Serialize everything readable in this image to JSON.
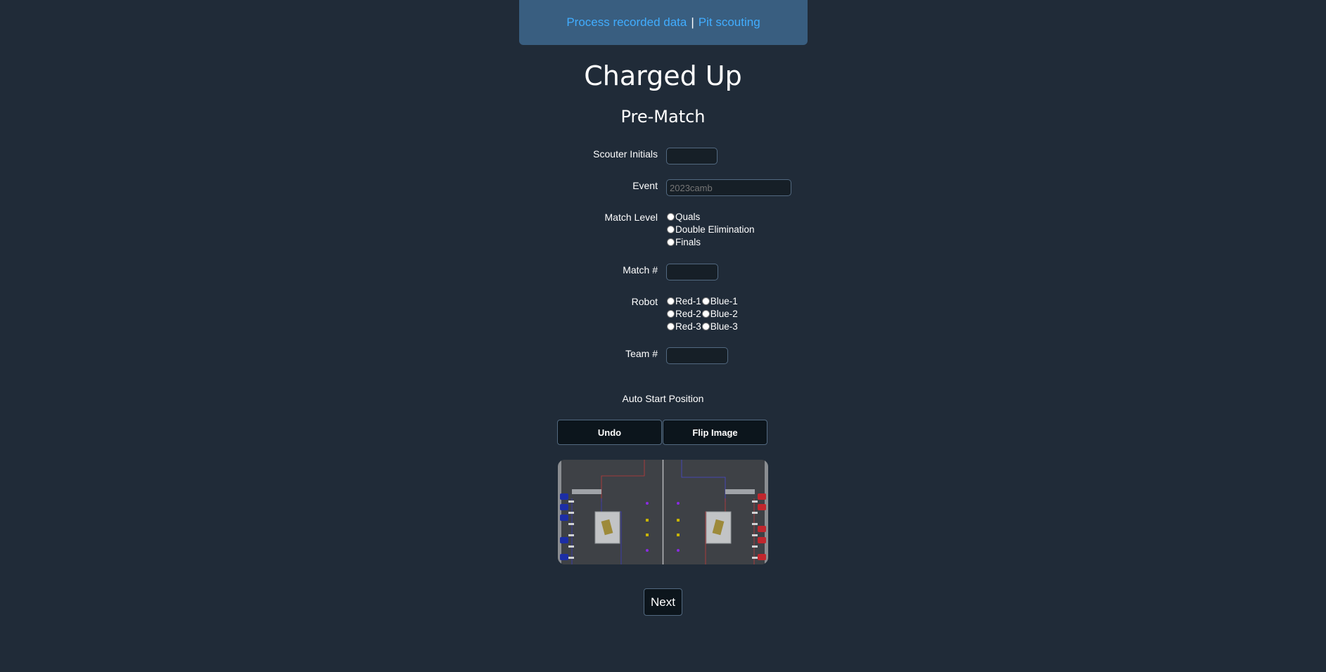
{
  "nav": {
    "process_link": "Process recorded data",
    "separator": "|",
    "pit_link": "Pit scouting"
  },
  "page_title": "Charged Up",
  "section_title": "Pre-Match",
  "form": {
    "scouter_initials": {
      "label": "Scouter Initials",
      "value": ""
    },
    "event": {
      "label": "Event",
      "placeholder": "2023camb"
    },
    "match_level": {
      "label": "Match Level",
      "options": [
        "Quals",
        "Double Elimination",
        "Finals"
      ]
    },
    "match_number": {
      "label": "Match #",
      "value": ""
    },
    "robot": {
      "label": "Robot",
      "options": [
        [
          "Red-1",
          "Blue-1"
        ],
        [
          "Red-2",
          "Blue-2"
        ],
        [
          "Red-3",
          "Blue-3"
        ]
      ]
    },
    "team_number": {
      "label": "Team #",
      "value": ""
    }
  },
  "auto_start": {
    "label": "Auto Start Position",
    "undo_label": "Undo",
    "flip_label": "Flip Image"
  },
  "next_label": "Next",
  "colors": {
    "background": "#202b38",
    "nav_background": "#395e80",
    "link": "#41adff",
    "red_alliance": "#c0262d",
    "blue_alliance": "#1c2ea5"
  }
}
